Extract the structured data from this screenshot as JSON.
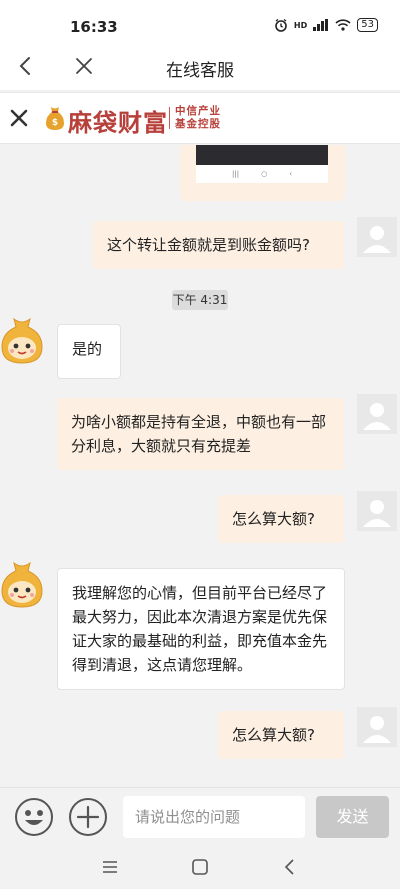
{
  "status": {
    "time": "16:33",
    "network": "HD",
    "battery": "53"
  },
  "titlebar": {
    "title": "在线客服"
  },
  "brand": {
    "name": "麻袋财富",
    "sub_line1": "中信产业",
    "sub_line2": "基金控股"
  },
  "messages": [
    {
      "side": "right",
      "text": "这个转让金额就是到账金额吗?"
    },
    {
      "side": "left",
      "text": "是的"
    },
    {
      "side": "right",
      "text": "为啥小额都是持有全退，中额也有一部分利息，大额就只有充提差"
    },
    {
      "side": "right",
      "text": "怎么算大额?"
    },
    {
      "side": "left",
      "text": "我理解您的心情，但目前平台已经尽了最大努力，因此本次清退方案是优先保证大家的最基础的利益，即充值本金先得到清退，这点请您理解。"
    },
    {
      "side": "right",
      "text": "怎么算大额?"
    }
  ],
  "timestamp": "下午 4:31",
  "input": {
    "placeholder": "请说出您的问题",
    "send_label": "发送"
  },
  "colors": {
    "brand": "#b8403a",
    "user_bubble": "#fdf0e3",
    "bot_bubble": "#ffffff"
  }
}
